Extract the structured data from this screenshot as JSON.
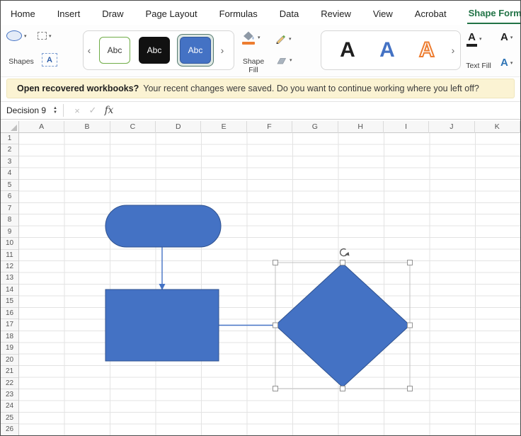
{
  "tabs": [
    {
      "label": "Home"
    },
    {
      "label": "Insert"
    },
    {
      "label": "Draw"
    },
    {
      "label": "Page Layout"
    },
    {
      "label": "Formulas"
    },
    {
      "label": "Data"
    },
    {
      "label": "Review"
    },
    {
      "label": "View"
    },
    {
      "label": "Acrobat"
    },
    {
      "label": "Shape Format",
      "active": true
    }
  ],
  "ribbon": {
    "shapes_label": "Shapes",
    "textbox_letter": "A",
    "gallery": [
      "Abc",
      "Abc",
      "Abc"
    ],
    "prev_arrow": "‹",
    "next_arrow": "›",
    "shape_fill_label_1": "Shape",
    "shape_fill_label_2": "Fill",
    "wordart": [
      "A",
      "A",
      "A"
    ],
    "text_fill_label": "Text Fill",
    "text_outline_letter": "A",
    "text_effects_letter": "A"
  },
  "icons": {
    "caret": "▾",
    "spinner_up": "▲",
    "spinner_down": "▼"
  },
  "notification": {
    "bold": "Open recovered workbooks?",
    "text": "Your recent changes were saved. Do you want to continue working where you left off?"
  },
  "formula_bar": {
    "name_box": "Decision 9",
    "cancel": "×",
    "accept": "✓",
    "fx": "fx"
  },
  "grid": {
    "columns": [
      "A",
      "B",
      "C",
      "D",
      "E",
      "F",
      "G",
      "H",
      "I",
      "J",
      "K"
    ],
    "rows": [
      "1",
      "2",
      "3",
      "4",
      "5",
      "6",
      "7",
      "8",
      "9",
      "10",
      "11",
      "12",
      "13",
      "14",
      "15",
      "16",
      "17",
      "18",
      "19",
      "20",
      "21",
      "22",
      "23",
      "24",
      "25",
      "26"
    ]
  },
  "shapes": {
    "selected_shape": "Decision 9",
    "items": [
      "flowchart-terminator",
      "flowchart-process",
      "flowchart-decision"
    ]
  },
  "colors": {
    "shape_fill": "#4472C4",
    "shape_outline": "#2F528F",
    "connector": "#4472C4",
    "accent_green": "#217346",
    "fill_indicator_orange": "#ED7D31",
    "wordart_orange": "#ED7D31",
    "notification_bg": "#FBF3D3"
  }
}
